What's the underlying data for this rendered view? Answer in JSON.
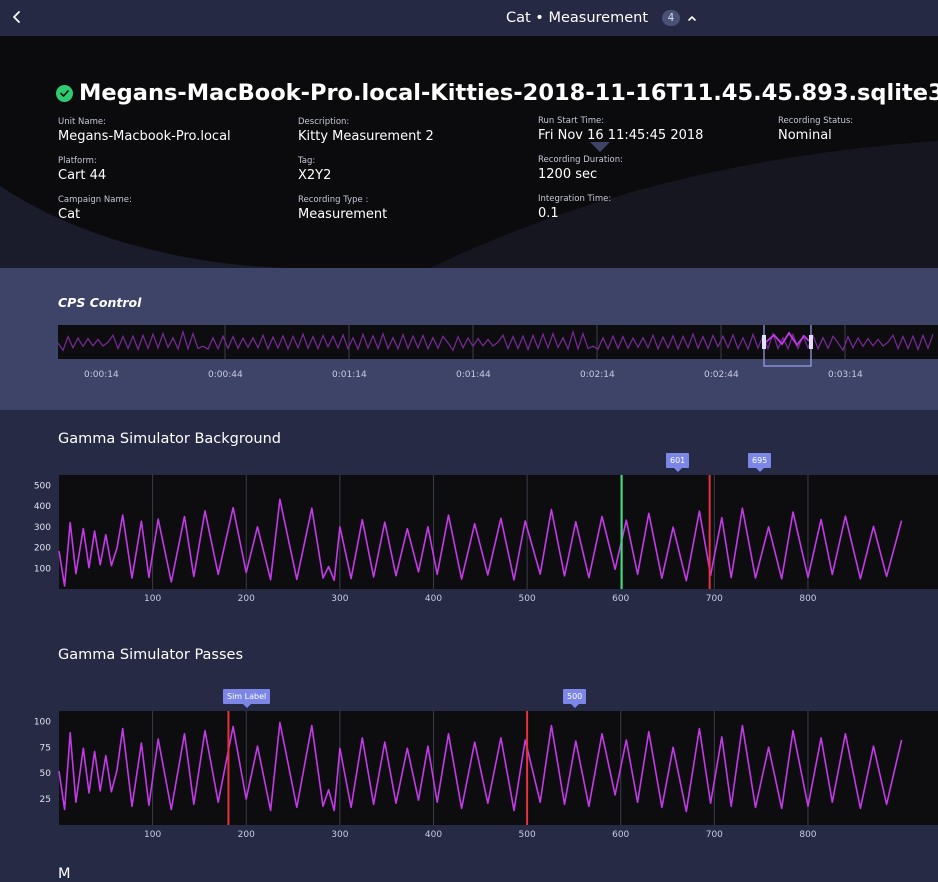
{
  "topbar": {
    "title": "Cat • Measurement",
    "count": "4"
  },
  "file": {
    "name": "Megans-MacBook-Pro.local-Kitties-2018-11-16T11.45.45.893.sqlite3",
    "status": "ok"
  },
  "meta": {
    "unit_name_label": "Unit Name:",
    "unit_name": "Megans-Macbook-Pro.local",
    "platform_label": "Platform:",
    "platform": "Cart 44",
    "campaign_label": "Campaign Name:",
    "campaign": "Cat",
    "description_label": "Description:",
    "description": "Kitty Measurement 2",
    "tag_label": "Tag:",
    "tag": "X2Y2",
    "recording_type_label": "Recording Type :",
    "recording_type": "Measurement",
    "run_start_label": "Run Start Time:",
    "run_start": "Fri Nov 16 11:45:45 2018",
    "duration_label": "Recording Duration:",
    "duration": "1200 sec",
    "integration_label": "Integration Time:",
    "integration": "0.1",
    "status_label": "Recording Status:",
    "status": "Nominal"
  },
  "cps": {
    "title": "CPS  Control",
    "ticks": [
      "0:00:14",
      "0:00:44",
      "0:01:14",
      "0:01:44",
      "0:02:14",
      "0:02:44",
      "0:03:14"
    ]
  },
  "charts": {
    "background": {
      "title": "Gamma Simulator Background",
      "markers": [
        {
          "label": "601",
          "x": 601,
          "color": "#3ee07a"
        },
        {
          "label": "695",
          "x": 695,
          "color": "#e8323c"
        }
      ]
    },
    "passes": {
      "title": "Gamma Simulator Passes",
      "markers": [
        {
          "label": "Sim Label",
          "x": 181,
          "color": "#e8323c"
        },
        {
          "label": "500",
          "x": 500,
          "color": "#e8323c"
        }
      ]
    }
  },
  "next_section": {
    "title": "M"
  },
  "colors": {
    "series": "#c43ae8",
    "plot_bg": "#0d0d10",
    "panel": "#262a45",
    "cps_panel": "#3e4368",
    "marker_tag": "#7b86e6"
  },
  "chart_data": [
    {
      "type": "line",
      "title": "Gamma Simulator Background",
      "xlabel": "",
      "ylabel": "",
      "xlim": [
        0,
        862
      ],
      "ylim": [
        0,
        550
      ],
      "xticks": [
        100,
        200,
        300,
        400,
        500,
        600,
        700,
        800
      ],
      "yticks": [
        100,
        200,
        300,
        400,
        500
      ],
      "grid": true,
      "series": [
        {
          "x": [
            0,
            6,
            12,
            18,
            26,
            32,
            38,
            44,
            50,
            56,
            62,
            68,
            78,
            88,
            96,
            106,
            120,
            134,
            144,
            156,
            170,
            186,
            200,
            212,
            226,
            236,
            254,
            270,
            282,
            288,
            294,
            300,
            312,
            324,
            336,
            348,
            360,
            372,
            384,
            394,
            404,
            416,
            430,
            444,
            458,
            472,
            486,
            498,
            514,
            526,
            540,
            552,
            566,
            580,
            594,
            606,
            618,
            630,
            644,
            656,
            670,
            684,
            696,
            708,
            718,
            730,
            744,
            758,
            772,
            784,
            800,
            814,
            826,
            840,
            856,
            870,
            884,
            900
          ],
          "y": [
            183,
            15,
            321,
            74,
            292,
            103,
            280,
            117,
            262,
            113,
            198,
            357,
            53,
            327,
            56,
            337,
            34,
            350,
            60,
            377,
            71,
            392,
            79,
            300,
            45,
            433,
            47,
            390,
            53,
            108,
            42,
            300,
            50,
            335,
            58,
            323,
            64,
            291,
            83,
            300,
            71,
            356,
            48,
            315,
            68,
            341,
            44,
            328,
            72,
            383,
            63,
            324,
            55,
            350,
            95,
            332,
            71,
            365,
            52,
            298,
            40,
            376,
            66,
            344,
            55,
            390,
            53,
            300,
            49,
            371,
            56,
            336,
            70,
            351,
            49,
            302,
            61,
            330
          ]
        }
      ],
      "markers": [
        {
          "label": "601",
          "x": 601
        },
        {
          "label": "695",
          "x": 695
        }
      ]
    },
    {
      "type": "line",
      "title": "Gamma Simulator Passes",
      "xlabel": "",
      "ylabel": "",
      "xlim": [
        0,
        862
      ],
      "ylim": [
        0,
        110
      ],
      "xticks": [
        100,
        200,
        300,
        400,
        500,
        600,
        700,
        800
      ],
      "yticks": [
        25,
        50,
        75,
        100
      ],
      "grid": true,
      "series": [
        {
          "x": [
            0,
            6,
            12,
            18,
            26,
            32,
            38,
            44,
            50,
            56,
            62,
            68,
            78,
            88,
            96,
            106,
            120,
            134,
            144,
            156,
            170,
            186,
            200,
            212,
            226,
            236,
            254,
            270,
            282,
            288,
            294,
            300,
            312,
            324,
            336,
            348,
            360,
            372,
            384,
            394,
            404,
            416,
            430,
            444,
            458,
            472,
            486,
            498,
            514,
            526,
            540,
            552,
            566,
            580,
            594,
            606,
            618,
            630,
            644,
            656,
            670,
            684,
            696,
            708,
            718,
            730,
            744,
            758,
            772,
            784,
            800,
            814,
            826,
            840,
            856,
            870,
            884,
            900
          ],
          "y": [
            52,
            15,
            89,
            22,
            74,
            31,
            71,
            33,
            67,
            32,
            53,
            93,
            18,
            79,
            19,
            83,
            15,
            88,
            20,
            91,
            22,
            95,
            25,
            76,
            14,
            99,
            17,
            96,
            18,
            34,
            14,
            74,
            17,
            84,
            20,
            80,
            21,
            74,
            24,
            76,
            22,
            88,
            16,
            80,
            21,
            84,
            14,
            82,
            22,
            96,
            20,
            81,
            18,
            88,
            29,
            82,
            22,
            90,
            17,
            75,
            13,
            93,
            21,
            85,
            18,
            96,
            17,
            75,
            16,
            91,
            18,
            84,
            22,
            88,
            16,
            76,
            20,
            82
          ]
        }
      ],
      "markers": [
        {
          "label": "Sim Label",
          "x": 181
        },
        {
          "label": "500",
          "x": 500
        }
      ]
    }
  ]
}
